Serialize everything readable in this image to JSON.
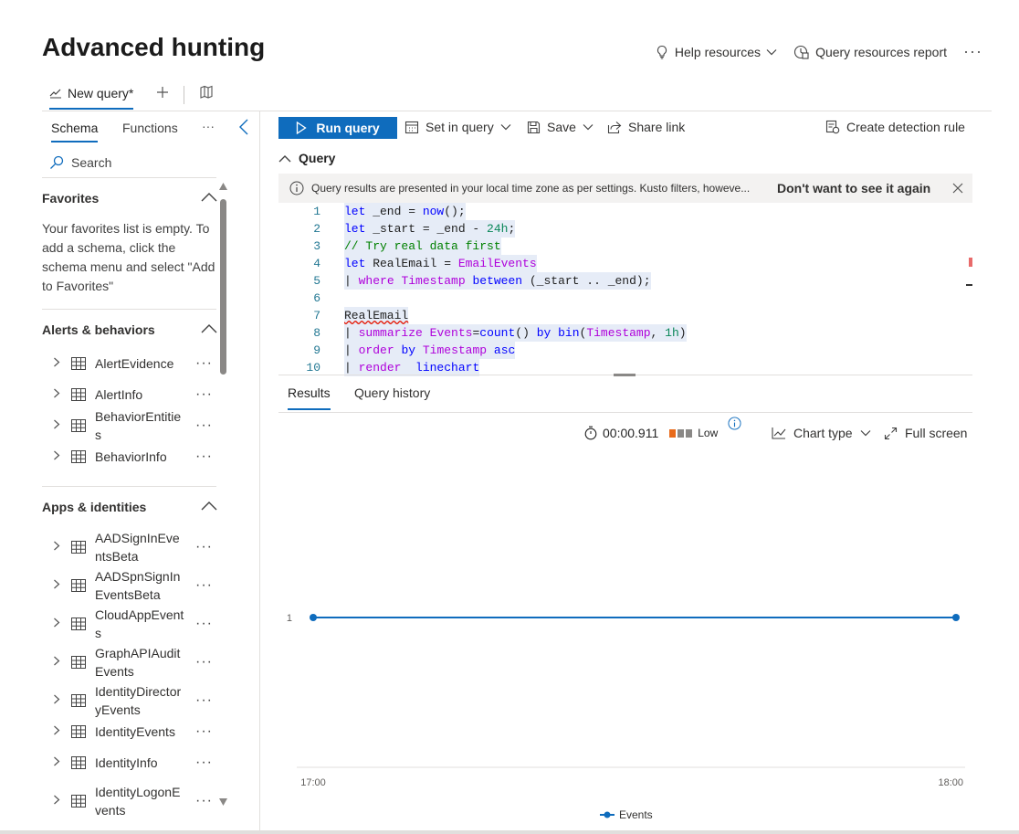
{
  "page": {
    "title": "Advanced hunting",
    "help_resources": "Help resources",
    "query_resources_report": "Query resources report",
    "more": "···"
  },
  "query_tabs": {
    "active_tab": "New query*"
  },
  "schema_panel": {
    "tabs": [
      "Schema",
      "Functions"
    ],
    "more": "···",
    "search_placeholder": "Search",
    "favorites": {
      "header": "Favorites",
      "empty_text": "Your favorites list is empty. To add a schema, click the schema menu and select \"Add to Favorites\""
    },
    "alerts": {
      "header": "Alerts & behaviors",
      "items": [
        "AlertEvidence",
        "AlertInfo",
        "BehaviorEntities",
        "BehaviorInfo"
      ]
    },
    "apps": {
      "header": "Apps & identities",
      "items": [
        "AADSignInEventsBeta",
        "AADSpnSignInEventsBeta",
        "CloudAppEvents",
        "GraphAPIAuditEvents",
        "IdentityDirectoryEvents",
        "IdentityEvents",
        "IdentityInfo",
        "IdentityLogonEvents"
      ]
    },
    "item_more": "···"
  },
  "toolbar": {
    "run_query": "Run query",
    "set_in_query": "Set in query",
    "save": "Save",
    "share_link": "Share link",
    "create_detection_rule": "Create detection rule"
  },
  "query_section": {
    "header": "Query",
    "info_message": "Query results are presented in your local time zone as per settings. Kusto filters, howeve...",
    "dismiss_forever": "Don't want to see it again"
  },
  "editor": {
    "line_numbers": [
      "1",
      "2",
      "3",
      "4",
      "5",
      "6",
      "7",
      "8",
      "9",
      "10"
    ],
    "lines": [
      "let _end = now();",
      "let _start = _end - 24h;",
      "// Try real data first",
      "let RealEmail = EmailEvents",
      "| where Timestamp between (_start .. _end);",
      "",
      "RealEmail",
      "| summarize Events=count() by bin(Timestamp, 1h)",
      "| order by Timestamp asc",
      "| render  linechart"
    ]
  },
  "results": {
    "tabs": [
      "Results",
      "Query history"
    ],
    "duration": "00:00.911",
    "usage_level": "Low",
    "chart_type": "Chart type",
    "full_screen": "Full screen"
  },
  "colors": {
    "accent": "#0f6cbd",
    "usage_bar": [
      "#e86a1a",
      "#8a8886",
      "#8a8886"
    ]
  },
  "chart_data": {
    "type": "line",
    "x": [
      "17:00",
      "18:00"
    ],
    "series": [
      {
        "name": "Events",
        "values": [
          1,
          1
        ]
      }
    ],
    "yticks": [
      1
    ],
    "legend": "bottom-center",
    "grid": false
  }
}
